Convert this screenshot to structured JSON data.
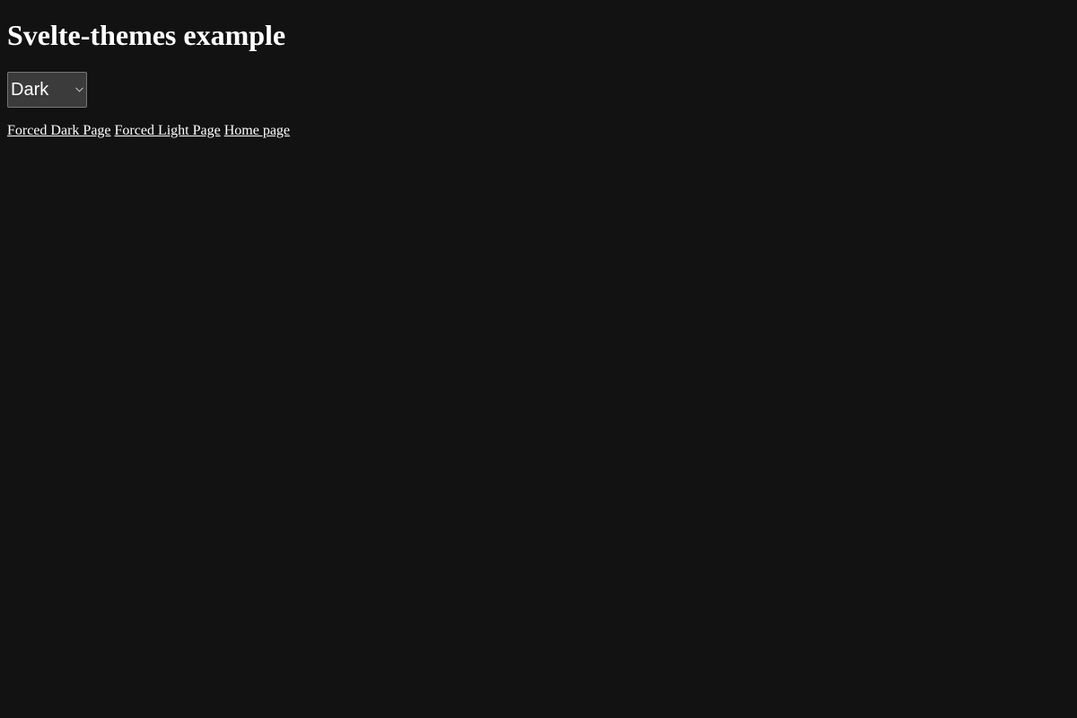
{
  "page": {
    "title": "Svelte-themes example"
  },
  "theme_select": {
    "selected": "Dark"
  },
  "links": [
    {
      "label": "Forced Dark Page"
    },
    {
      "label": "Forced Light Page"
    },
    {
      "label": "Home page"
    }
  ],
  "colors": {
    "background": "#121212",
    "text": "#ffffff",
    "select_background": "#3b3b3b",
    "select_border": "#767676"
  },
  "icons": {
    "select_chevron": "chevron-down-icon"
  }
}
